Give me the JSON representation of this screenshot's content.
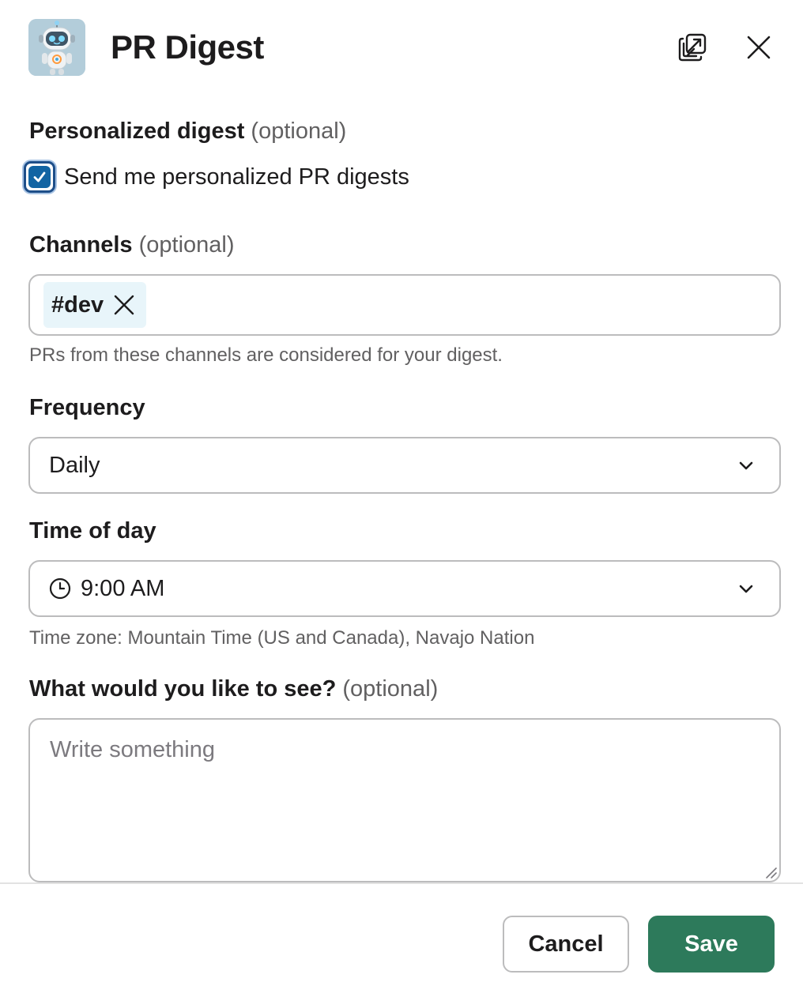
{
  "header": {
    "title": "PR Digest",
    "app_icon": "robot-avatar-icon",
    "popout_icon": "popout-windows-icon",
    "close_icon": "close-icon"
  },
  "personalized": {
    "label": "Personalized digest",
    "optional": "(optional)",
    "checkbox_label": "Send me personalized PR digests",
    "checked": true
  },
  "channels": {
    "label": "Channels",
    "optional": "(optional)",
    "selected": [
      "#dev"
    ],
    "help": "PRs from these channels are considered for your digest."
  },
  "frequency": {
    "label": "Frequency",
    "value": "Daily"
  },
  "time_of_day": {
    "label": "Time of day",
    "value": "9:00 AM",
    "timezone": "Time zone: Mountain Time (US and Canada), Navajo Nation"
  },
  "notes": {
    "label": "What would you like to see?",
    "optional": "(optional)",
    "placeholder": "Write something",
    "value": ""
  },
  "footer": {
    "cancel_label": "Cancel",
    "save_label": "Save"
  },
  "colors": {
    "accent": "#1264a3",
    "save_button": "#2d7a5b",
    "chip_bg": "#e8f5fa"
  }
}
